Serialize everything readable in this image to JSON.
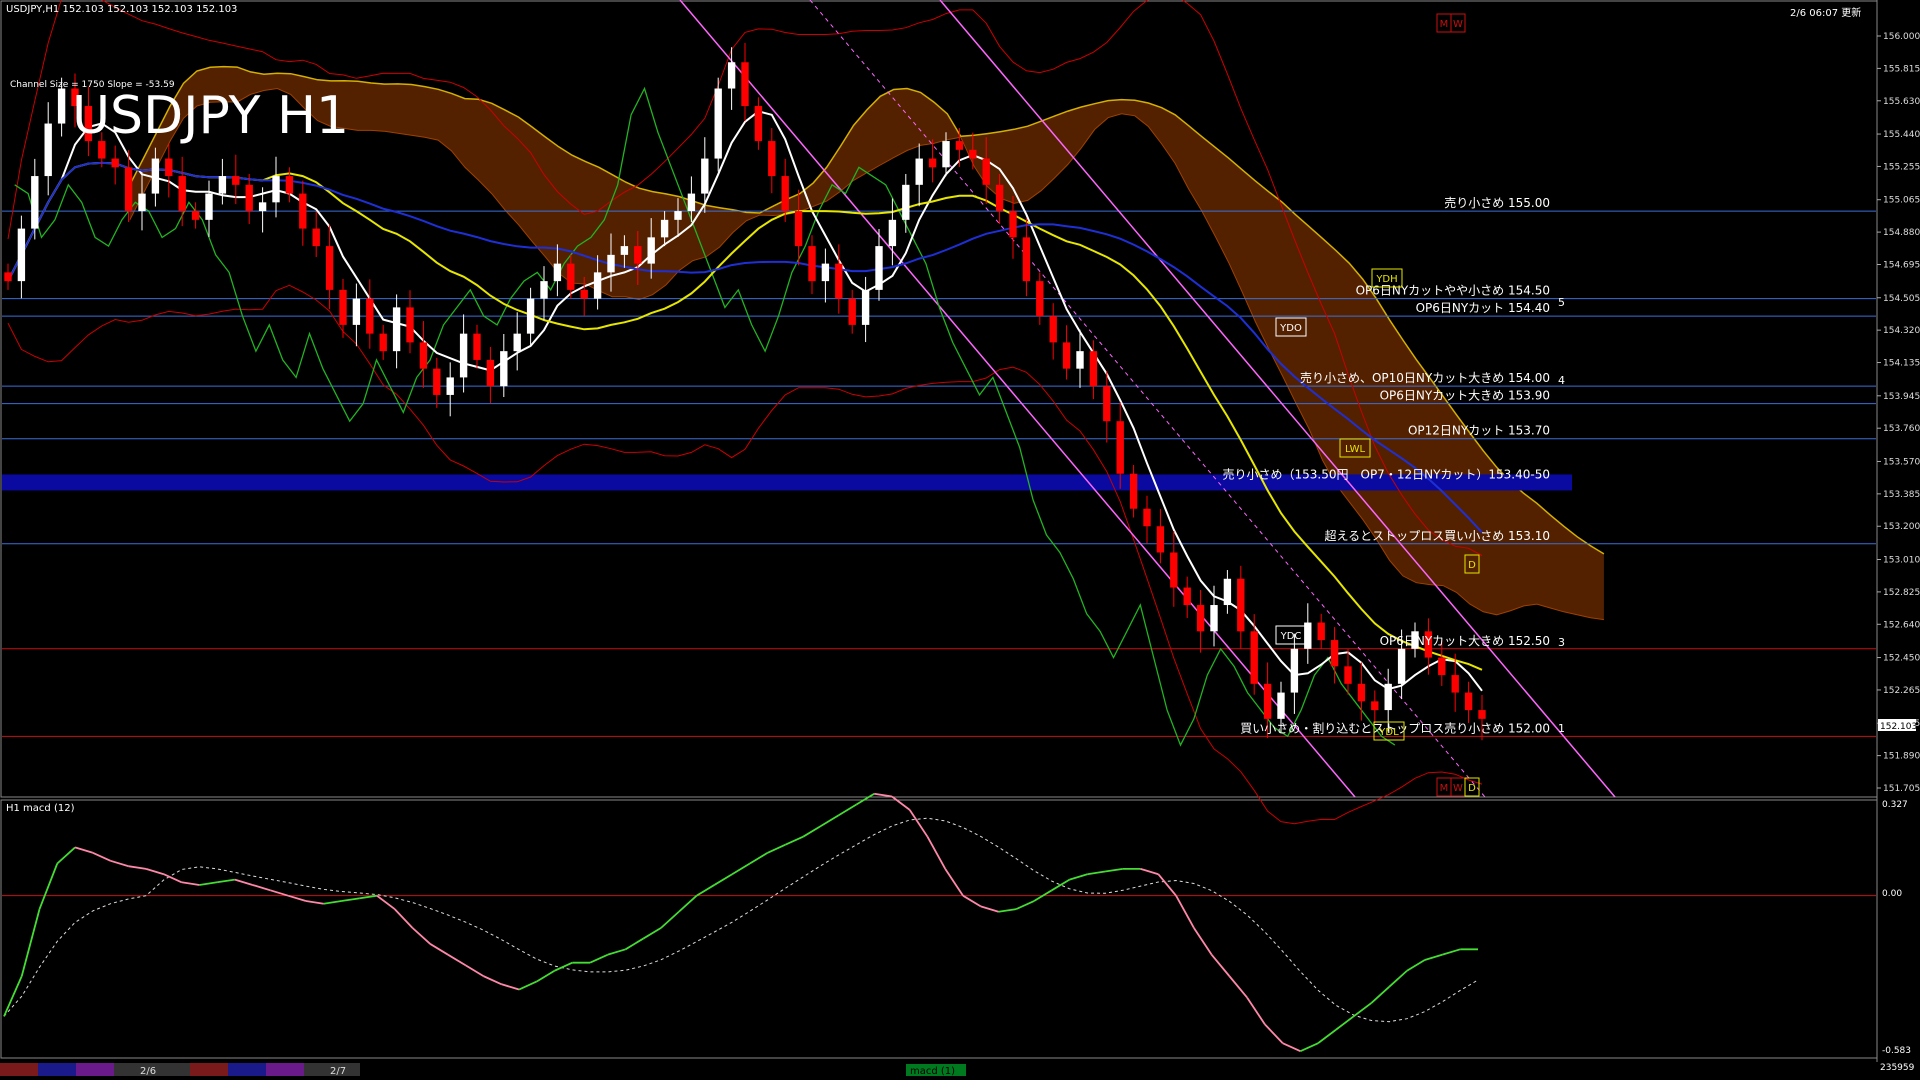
{
  "header": {
    "symbol_info": "USDJPY,H1  152.103 152.103 152.103 152.103",
    "channel_info": "Channel Size = 1750 Slope = -53.59",
    "big_title": "USDJPY H1",
    "server_time": "2/6 06:07 更新"
  },
  "colors": {
    "background": "#000000",
    "bull_candle": "#ffffff",
    "bear_candle": "#ff0000",
    "ma_white": "#ffffff",
    "ma_yellow": "#e6e600",
    "ma_blue": "#1e2fd6",
    "chikou": "#22b322",
    "bollinger": "#cc0000",
    "channel": "#ff66ff",
    "kumo": "#b84a00",
    "level_blue": "#3a6fd8",
    "zone_band": "#0a0aa0",
    "macd_up": "#44dd33",
    "macd_down": "#ff88aa"
  },
  "price_axis": {
    "ticks": [
      "156.000",
      "155.815",
      "155.630",
      "155.440",
      "155.255",
      "155.065",
      "154.880",
      "154.695",
      "154.505",
      "154.320",
      "154.135",
      "153.945",
      "153.760",
      "153.570",
      "153.385",
      "153.200",
      "153.010",
      "152.825",
      "152.640",
      "152.450",
      "152.265",
      "152.075",
      "151.890",
      "151.705"
    ],
    "current_price": "152.103"
  },
  "macd_axis": {
    "ticks": [
      "0.327",
      "0.00",
      "-0.583"
    ],
    "label": "H1  macd (12)",
    "corner_value": "235959"
  },
  "annotations": [
    {
      "text": "売り小さめ 155.00"
    },
    {
      "text": "OP6日NYカットやや小さめ 154.50"
    },
    {
      "text": "OP6日NYカット 154.40"
    },
    {
      "text": "売り小さめ、OP10日NYカット大きめ 154.00"
    },
    {
      "text": "OP6日NYカット大きめ 153.90"
    },
    {
      "text": "OP12日NYカット 153.70"
    },
    {
      "text": "売り小さめ（153.50円　OP7・12日NYカット）153.40-50"
    },
    {
      "text": "超えるとストップロス買い小さめ 153.10"
    },
    {
      "text": "OP6日NYカット大きめ 152.50"
    },
    {
      "text": "買い小さめ・割り込むとストップロス売り小さめ 152.00"
    }
  ],
  "boxes": [
    "YDH",
    "YDO",
    "YDC",
    "YDL",
    "LWL",
    "M",
    "W",
    "D",
    "M",
    "W",
    "D"
  ],
  "channel_numbers": [
    "5",
    "4",
    "3",
    "1"
  ],
  "bottom_bar": {
    "dates": [
      "2/6",
      "2/7"
    ],
    "indicator_tab": "macd (1)"
  },
  "chart_data": {
    "type": "candlestick",
    "title": "USDJPY H1",
    "timeframe": "H1",
    "ylim": [
      151.705,
      156.0
    ],
    "x_labels": [
      "2/6",
      "2/7"
    ],
    "levels": [
      {
        "price": 155.0,
        "label": "売り小さめ 155.00"
      },
      {
        "price": 154.5,
        "label": "OP6日NYカットやや小さめ 154.50"
      },
      {
        "price": 154.4,
        "label": "OP6日NYカット 154.40"
      },
      {
        "price": 154.0,
        "label": "売り小さめ、OP10日NYカット大きめ 154.00"
      },
      {
        "price": 153.9,
        "label": "OP6日NYカット大きめ 153.90"
      },
      {
        "price": 153.7,
        "label": "OP12日NYカット 153.70"
      },
      {
        "price": 153.45,
        "label": "売り小さめ（153.50円　OP7・12日NYカット）153.40-50"
      },
      {
        "price": 153.1,
        "label": "超えるとストップロス買い小さめ 153.10"
      },
      {
        "price": 152.5,
        "label": "OP6日NYカット大きめ 152.50"
      },
      {
        "price": 152.0,
        "label": "買い小さめ・割り込むとストップロス売り小さめ 152.00"
      }
    ],
    "close_series": [
      154.6,
      154.9,
      155.2,
      155.5,
      155.7,
      155.6,
      155.4,
      155.3,
      155.25,
      155.0,
      155.1,
      155.3,
      155.2,
      155.0,
      154.95,
      155.1,
      155.2,
      155.15,
      155.0,
      155.05,
      155.2,
      155.1,
      154.9,
      154.8,
      154.55,
      154.35,
      154.5,
      154.3,
      154.2,
      154.45,
      154.25,
      154.1,
      153.95,
      154.05,
      154.3,
      154.15,
      154.0,
      154.2,
      154.3,
      154.5,
      154.6,
      154.7,
      154.55,
      154.5,
      154.65,
      154.75,
      154.8,
      154.7,
      154.85,
      154.95,
      155.0,
      155.1,
      155.3,
      155.7,
      155.85,
      155.6,
      155.4,
      155.2,
      155.0,
      154.8,
      154.6,
      154.7,
      154.5,
      154.35,
      154.55,
      154.8,
      154.95,
      155.15,
      155.3,
      155.25,
      155.4,
      155.35,
      155.3,
      155.15,
      155.0,
      154.85,
      154.6,
      154.4,
      154.25,
      154.1,
      154.2,
      154.0,
      153.8,
      153.5,
      153.3,
      153.2,
      153.05,
      152.85,
      152.75,
      152.6,
      152.75,
      152.9,
      152.6,
      152.3,
      152.1,
      152.25,
      152.5,
      152.65,
      152.55,
      152.4,
      152.3,
      152.2,
      152.15,
      152.3,
      152.5,
      152.6,
      152.45,
      152.35,
      152.25,
      152.15,
      152.1
    ]
  },
  "macd_data": {
    "main": [
      -0.45,
      -0.3,
      -0.05,
      0.12,
      0.18,
      0.16,
      0.13,
      0.11,
      0.1,
      0.08,
      0.05,
      0.04,
      0.05,
      0.06,
      0.04,
      0.02,
      0.0,
      -0.02,
      -0.03,
      -0.02,
      -0.01,
      0.0,
      -0.05,
      -0.12,
      -0.18,
      -0.22,
      -0.26,
      -0.3,
      -0.33,
      -0.35,
      -0.32,
      -0.28,
      -0.25,
      -0.25,
      -0.22,
      -0.2,
      -0.16,
      -0.12,
      -0.06,
      0.0,
      0.04,
      0.08,
      0.12,
      0.16,
      0.19,
      0.22,
      0.26,
      0.3,
      0.34,
      0.38,
      0.37,
      0.32,
      0.22,
      0.1,
      0.0,
      -0.04,
      -0.06,
      -0.05,
      -0.02,
      0.02,
      0.06,
      0.08,
      0.09,
      0.1,
      0.1,
      0.08,
      0.0,
      -0.12,
      -0.22,
      -0.3,
      -0.38,
      -0.48,
      -0.55,
      -0.58,
      -0.55,
      -0.5,
      -0.45,
      -0.4,
      -0.34,
      -0.28,
      -0.24,
      -0.22,
      -0.2,
      -0.2
    ]
  }
}
